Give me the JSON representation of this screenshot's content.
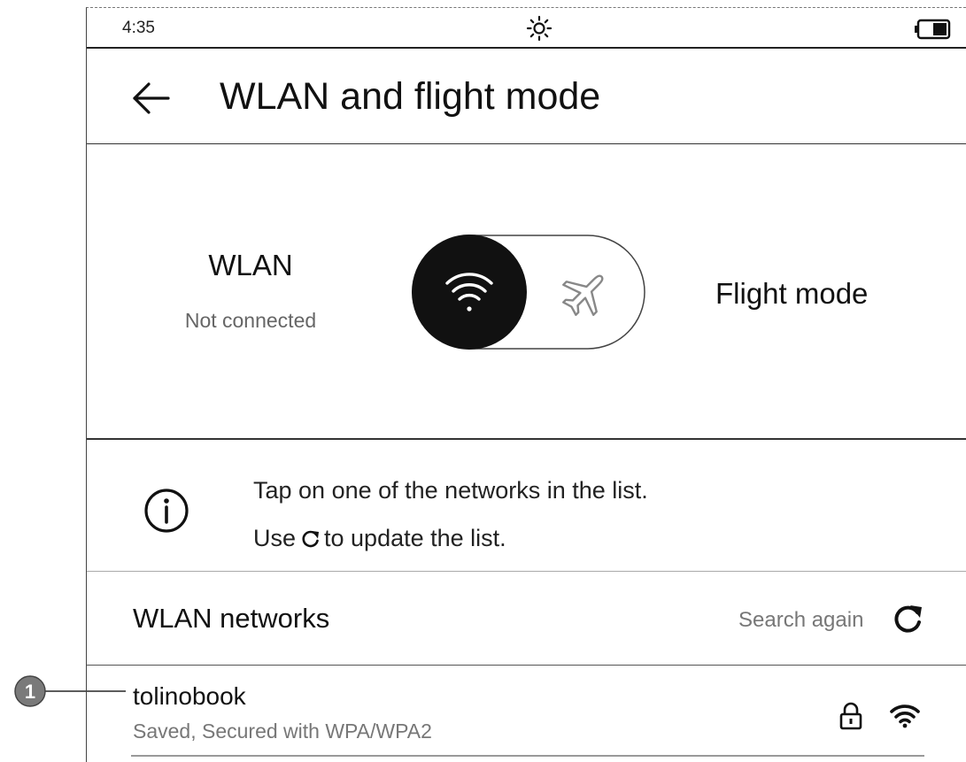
{
  "statusbar": {
    "time": "4:35",
    "brightness_icon": "sun-icon",
    "battery_icon": "battery-icon"
  },
  "header": {
    "back_icon": "back-arrow-icon",
    "title": "WLAN and flight mode"
  },
  "mode_switch": {
    "wlan_label": "WLAN",
    "wlan_status": "Not connected",
    "flight_label": "Flight mode",
    "active": "wlan",
    "wifi_icon": "wifi-icon",
    "airplane_icon": "airplane-icon"
  },
  "info": {
    "icon": "info-icon",
    "line1": "Tap on one of the networks in the list.",
    "line2_prefix": "Use",
    "line2_suffix": "to update the list."
  },
  "networks": {
    "title": "WLAN networks",
    "search_label": "Search again",
    "items": [
      {
        "name": "tolinobook",
        "status": "Saved, Secured with WPA/WPA2",
        "locked": true
      }
    ]
  },
  "callout": {
    "number": "1"
  },
  "colors": {
    "text": "#111111",
    "muted": "#777777",
    "toggle_knob": "#111111"
  }
}
